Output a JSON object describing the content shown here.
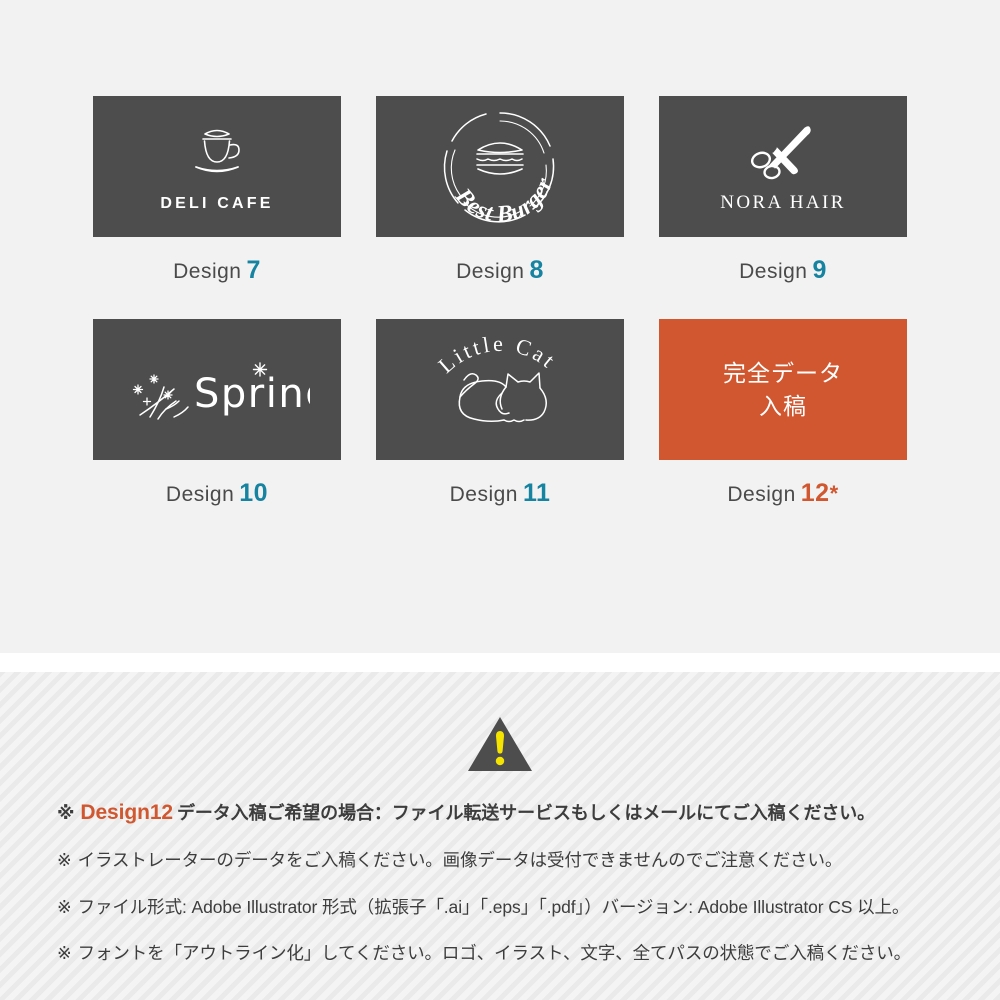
{
  "gallery": {
    "cards": [
      {
        "id": "design-7",
        "logo_name": "deli-cafe-logo",
        "icon": "coffee-cup-icon",
        "logo_text": "DELI CAFE",
        "caption_word": "Design",
        "caption_number": "7",
        "caption_star": "",
        "thumb_color": "#4d4d4d",
        "number_color": "#1683a0"
      },
      {
        "id": "design-8",
        "logo_name": "best-burger-logo",
        "icon": "burger-icon",
        "logo_text": "Best Burger",
        "caption_word": "Design",
        "caption_number": "8",
        "caption_star": "",
        "thumb_color": "#4d4d4d",
        "number_color": "#1683a0"
      },
      {
        "id": "design-9",
        "logo_name": "nora-hair-logo",
        "icon": "scissors-icon",
        "logo_text": "NORA HAIR",
        "caption_word": "Design",
        "caption_number": "9",
        "caption_star": "",
        "thumb_color": "#4d4d4d",
        "number_color": "#1683a0"
      },
      {
        "id": "design-10",
        "logo_name": "spring-logo",
        "icon": "flower-sprig-icon",
        "logo_text": "Spring",
        "caption_word": "Design",
        "caption_number": "10",
        "caption_star": "",
        "thumb_color": "#4d4d4d",
        "number_color": "#1683a0"
      },
      {
        "id": "design-11",
        "logo_name": "little-cat-logo",
        "icon": "cat-icon",
        "logo_text": "Little Cat",
        "caption_word": "Design",
        "caption_number": "11",
        "caption_star": "",
        "thumb_color": "#4d4d4d",
        "number_color": "#1683a0"
      },
      {
        "id": "design-12",
        "logo_name": "full-data-submission-card",
        "icon": "",
        "logo_text_line1": "完全データ",
        "logo_text_line2": "入稿",
        "caption_word": "Design",
        "caption_number": "12",
        "caption_star": "*",
        "thumb_color": "#d0572f",
        "number_color": "#d0572f"
      }
    ]
  },
  "notice": {
    "warning_icon": "warning-triangle-icon",
    "warning_icon_color": "#4d4d4d",
    "warning_mark_color": "#f5e400",
    "lines": [
      {
        "mark": "※",
        "highlight": "Design12",
        "text": "データ入稿ご希望の場合：ファイル転送サービスもしくはメールにてご入稿ください。",
        "bold": true
      },
      {
        "mark": "※",
        "highlight": "",
        "text": "イラストレーターのデータをご入稿ください。画像データは受付できませんのでご注意ください。",
        "bold": false
      },
      {
        "mark": "※",
        "highlight": "",
        "text": "ファイル形式: Adobe Illustrator 形式（拡張子「.ai」「.eps」「.pdf」）バージョン: Adobe Illustrator CS 以上。",
        "bold": false
      },
      {
        "mark": "※",
        "highlight": "",
        "text": "フォントを「アウトライン化」してください。ロゴ、イラスト、文字、全てパスの状態でご入稿ください。",
        "bold": false
      }
    ]
  },
  "theme": {
    "page_bg": "#ffffff",
    "gallery_bg": "#f2f2f2",
    "notice_bg": "#f0f0f0",
    "card_dark": "#4d4d4d",
    "accent_orange": "#d0572f",
    "accent_teal": "#1683a0",
    "text_dark": "#3d3d3d"
  }
}
